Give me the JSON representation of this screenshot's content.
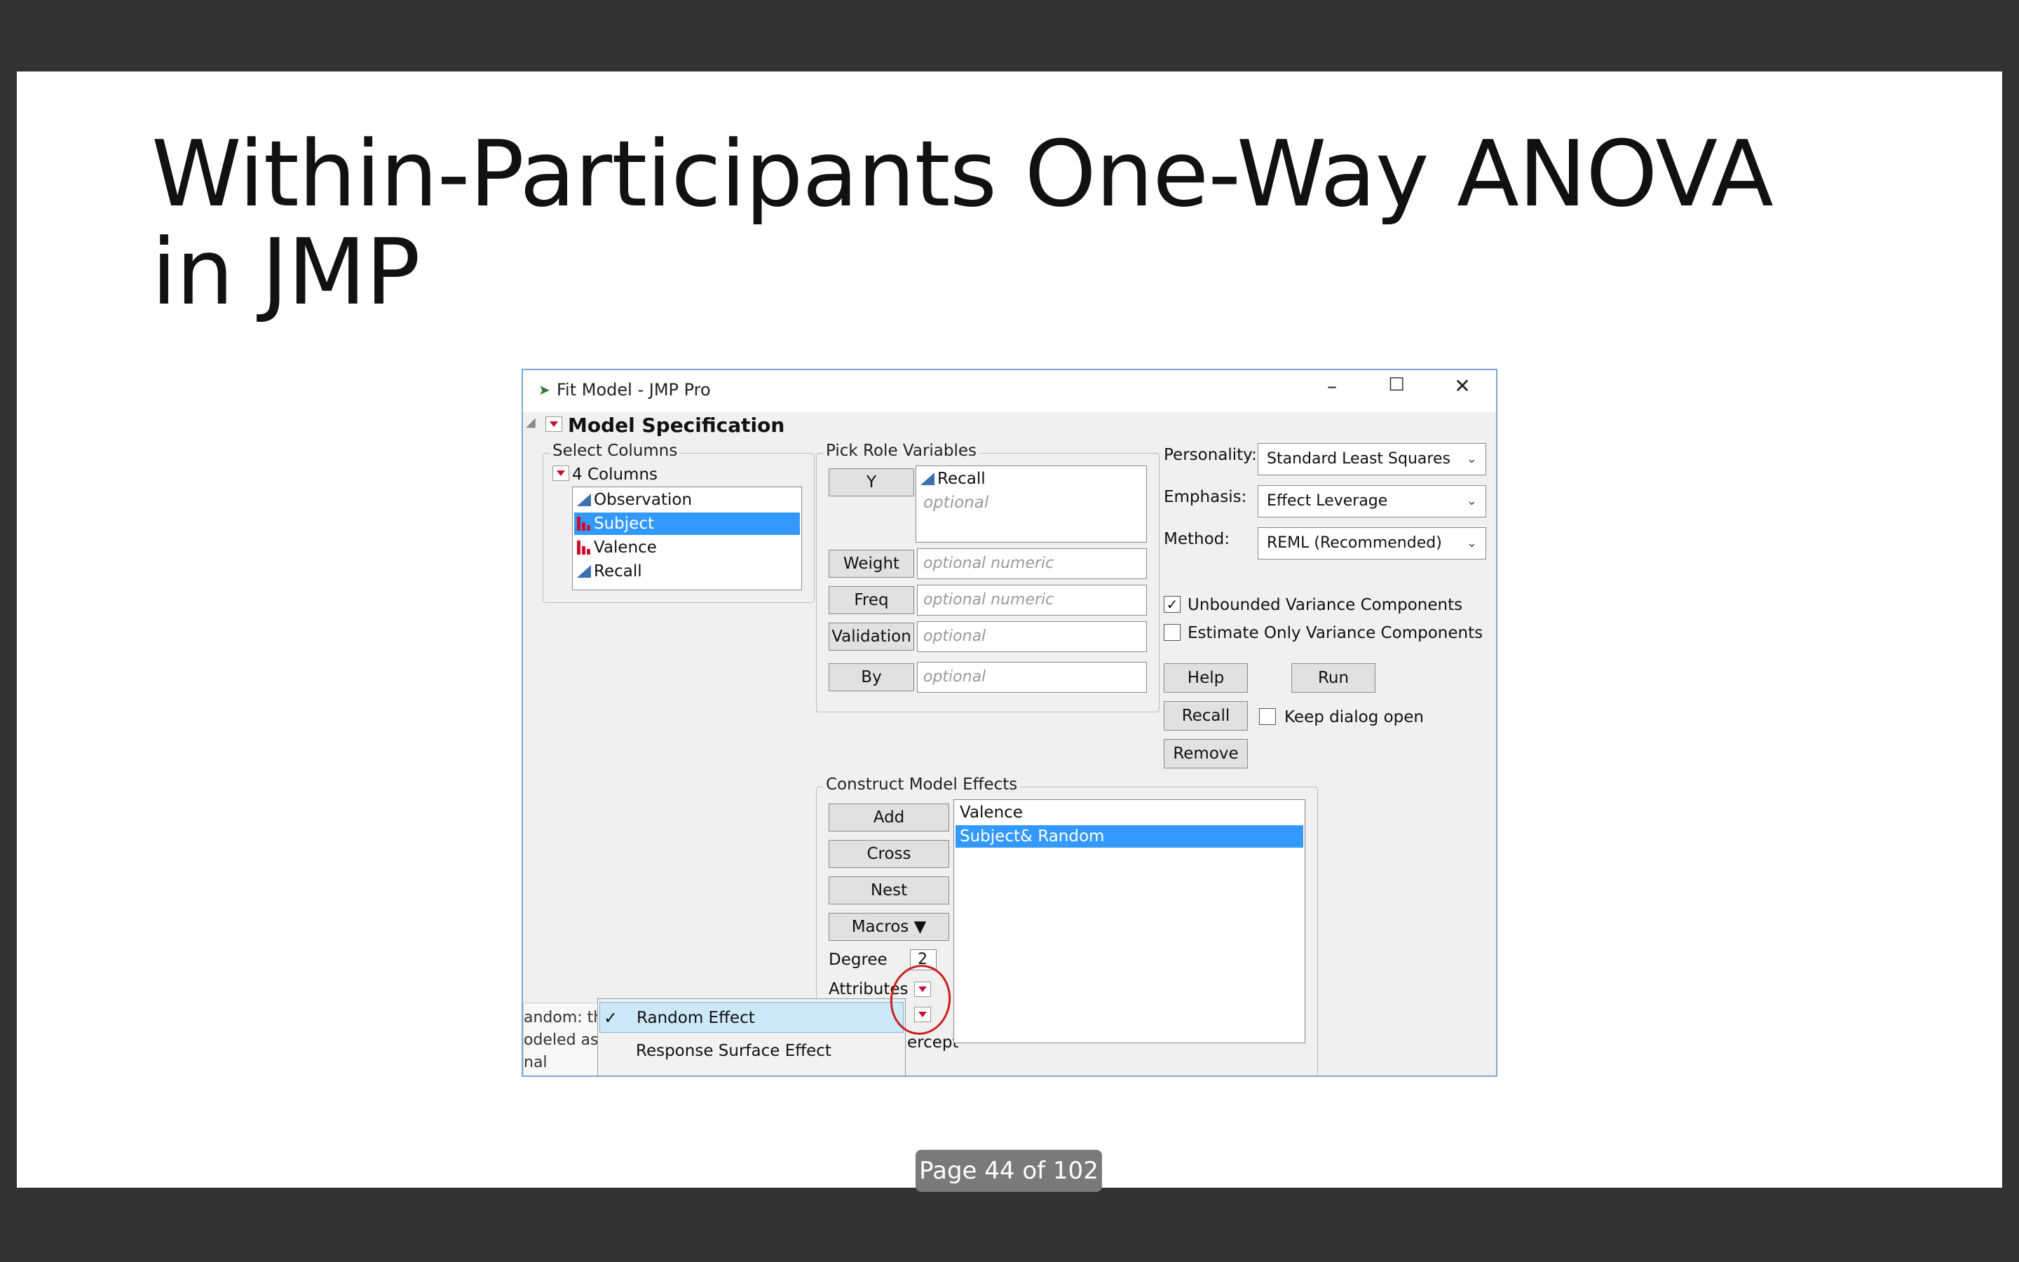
{
  "slide": {
    "title_line1": "Within-Participants One-Way ANOVA",
    "title_line2": "in JMP",
    "page_indicator": "Page 44 of 102"
  },
  "window": {
    "title": "Fit Model - JMP Pro",
    "minimize_glyph": "–",
    "maximize_glyph": "☐",
    "close_glyph": "✕"
  },
  "model_spec": {
    "header": "Model Specification"
  },
  "select_columns": {
    "label": "Select Columns",
    "count_label": "4 Columns",
    "items": [
      {
        "label": "Observation",
        "icon": "continuous-icon",
        "selected": false
      },
      {
        "label": "Subject",
        "icon": "nominal-icon",
        "selected": true
      },
      {
        "label": "Valence",
        "icon": "nominal-icon",
        "selected": false
      },
      {
        "label": "Recall",
        "icon": "continuous-icon",
        "selected": false
      }
    ]
  },
  "pick_role": {
    "label": "Pick Role Variables",
    "y_button": "Y",
    "y_values": [
      "Recall",
      "optional"
    ],
    "weight_button": "Weight",
    "weight_placeholder": "optional numeric",
    "freq_button": "Freq",
    "freq_placeholder": "optional numeric",
    "validation_button": "Validation",
    "validation_placeholder": "optional",
    "by_button": "By",
    "by_placeholder": "optional"
  },
  "settings": {
    "personality_label": "Personality:",
    "personality_value": "Standard Least Squares",
    "emphasis_label": "Emphasis:",
    "emphasis_value": "Effect Leverage",
    "method_label": "Method:",
    "method_value": "REML (Recommended)",
    "unbounded_label": "Unbounded Variance Components",
    "unbounded_checked": true,
    "estimate_only_label": "Estimate Only Variance Components",
    "estimate_only_checked": false,
    "help_button": "Help",
    "run_button": "Run",
    "recall_button": "Recall",
    "keep_open_label": "Keep dialog open",
    "keep_open_checked": false,
    "remove_button": "Remove"
  },
  "construct": {
    "label": "Construct Model Effects",
    "add_button": "Add",
    "cross_button": "Cross",
    "nest_button": "Nest",
    "macros_button": "Macros ▼",
    "degree_label": "Degree",
    "degree_value": "2",
    "attributes_label": "Attributes",
    "effects": [
      {
        "label": "Valence",
        "selected": false
      },
      {
        "label": "Subject& Random",
        "selected": true
      }
    ],
    "intercept_partial": "ercept"
  },
  "popup_menu": {
    "items": [
      {
        "label": "Random Effect",
        "checked": true,
        "highlighted": true
      },
      {
        "label": "Response Surface Effect",
        "checked": false,
        "highlighted": false
      }
    ],
    "check_glyph": "✓"
  },
  "tooltip_partial": {
    "lines": [
      "andom: the",
      "odeled as if",
      "nal"
    ]
  }
}
